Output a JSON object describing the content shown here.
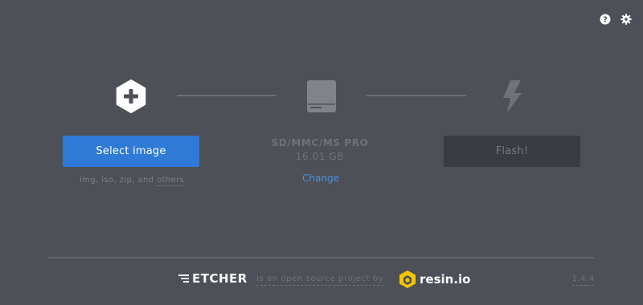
{
  "header": {
    "icons": [
      "help-icon",
      "settings-icon"
    ]
  },
  "steps": {
    "image": {
      "icon": "plus-hexagon-icon",
      "button_label": "Select image",
      "hint_prefix": "img, iso, zip, and",
      "hint_link": "others"
    },
    "drive": {
      "icon": "drive-icon",
      "name": "SD/MMC/MS PRO",
      "size": "16.01 GB",
      "change_label": "Change"
    },
    "flash": {
      "icon": "flash-icon",
      "button_label": "Flash!"
    }
  },
  "footer": {
    "brand": "ETCHER",
    "tagline": "is an open source project by",
    "partner": "resin.io",
    "version": "1.4.4"
  },
  "colors": {
    "background": "#4d5057",
    "primary": "#2f7ad6",
    "link": "#4a90dd",
    "muted": "#6f7277",
    "resin_yellow": "#f5c400"
  }
}
